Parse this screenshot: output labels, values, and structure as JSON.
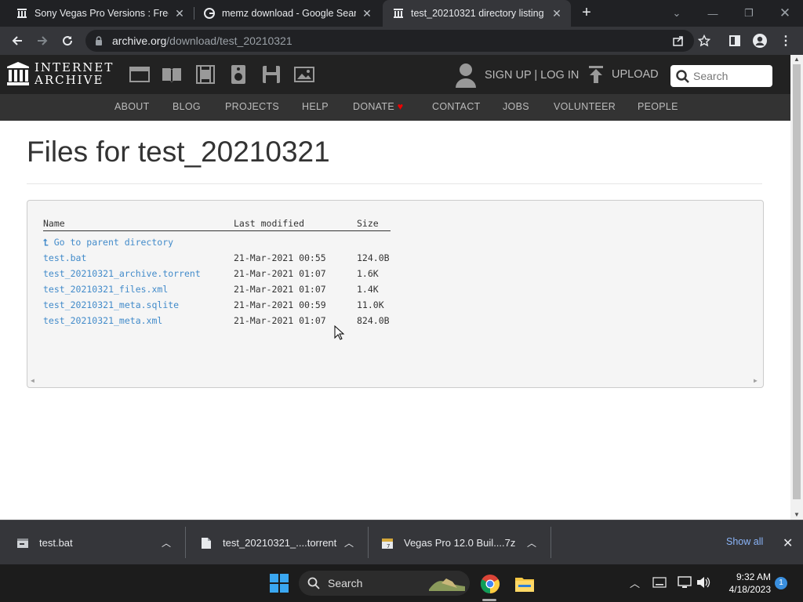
{
  "browser": {
    "tabs": [
      {
        "title": "Sony Vegas Pro Versions : Free D",
        "active": false,
        "favicon": "internet-archive-icon"
      },
      {
        "title": "memz download - Google Searc",
        "active": false,
        "favicon": "google-icon"
      },
      {
        "title": "test_20210321 directory listing",
        "active": true,
        "favicon": "internet-archive-icon"
      }
    ],
    "url_host": "archive.org",
    "url_path": "/download/test_20210321"
  },
  "site": {
    "logo_line1": "INTERNET",
    "logo_line2": "ARCHIVE",
    "signup_label": "SIGN UP | LOG IN",
    "upload_label": "UPLOAD",
    "search_placeholder": "Search",
    "nav": [
      "ABOUT",
      "BLOG",
      "PROJECTS",
      "HELP",
      "DONATE",
      "CONTACT",
      "JOBS",
      "VOLUNTEER",
      "PEOPLE"
    ],
    "donate_heart_color": "#e00"
  },
  "page": {
    "title": "Files for test_20210321",
    "columns": {
      "name": "Name",
      "modified": "Last modified",
      "size": "Size"
    },
    "parent_link": "Go to parent directory",
    "files": [
      {
        "name": "test.bat",
        "modified": "21-Mar-2021 00:55",
        "size": "124.0B"
      },
      {
        "name": "test_20210321_archive.torrent",
        "modified": "21-Mar-2021 01:07",
        "size": "1.6K"
      },
      {
        "name": "test_20210321_files.xml",
        "modified": "21-Mar-2021 01:07",
        "size": "1.4K"
      },
      {
        "name": "test_20210321_meta.sqlite",
        "modified": "21-Mar-2021 00:59",
        "size": "11.0K"
      },
      {
        "name": "test_20210321_meta.xml",
        "modified": "21-Mar-2021 01:07",
        "size": "824.0B"
      }
    ]
  },
  "downloads": {
    "items": [
      {
        "name": "test.bat",
        "icon": "batch-file-icon"
      },
      {
        "name": "test_20210321_....torrent",
        "icon": "file-icon"
      },
      {
        "name": "Vegas Pro 12.0 Buil....7z",
        "icon": "archive-file-icon"
      }
    ],
    "show_all": "Show all"
  },
  "taskbar": {
    "search_label": "Search",
    "time": "9:32 AM",
    "date": "4/18/2023",
    "notification_count": "1"
  }
}
